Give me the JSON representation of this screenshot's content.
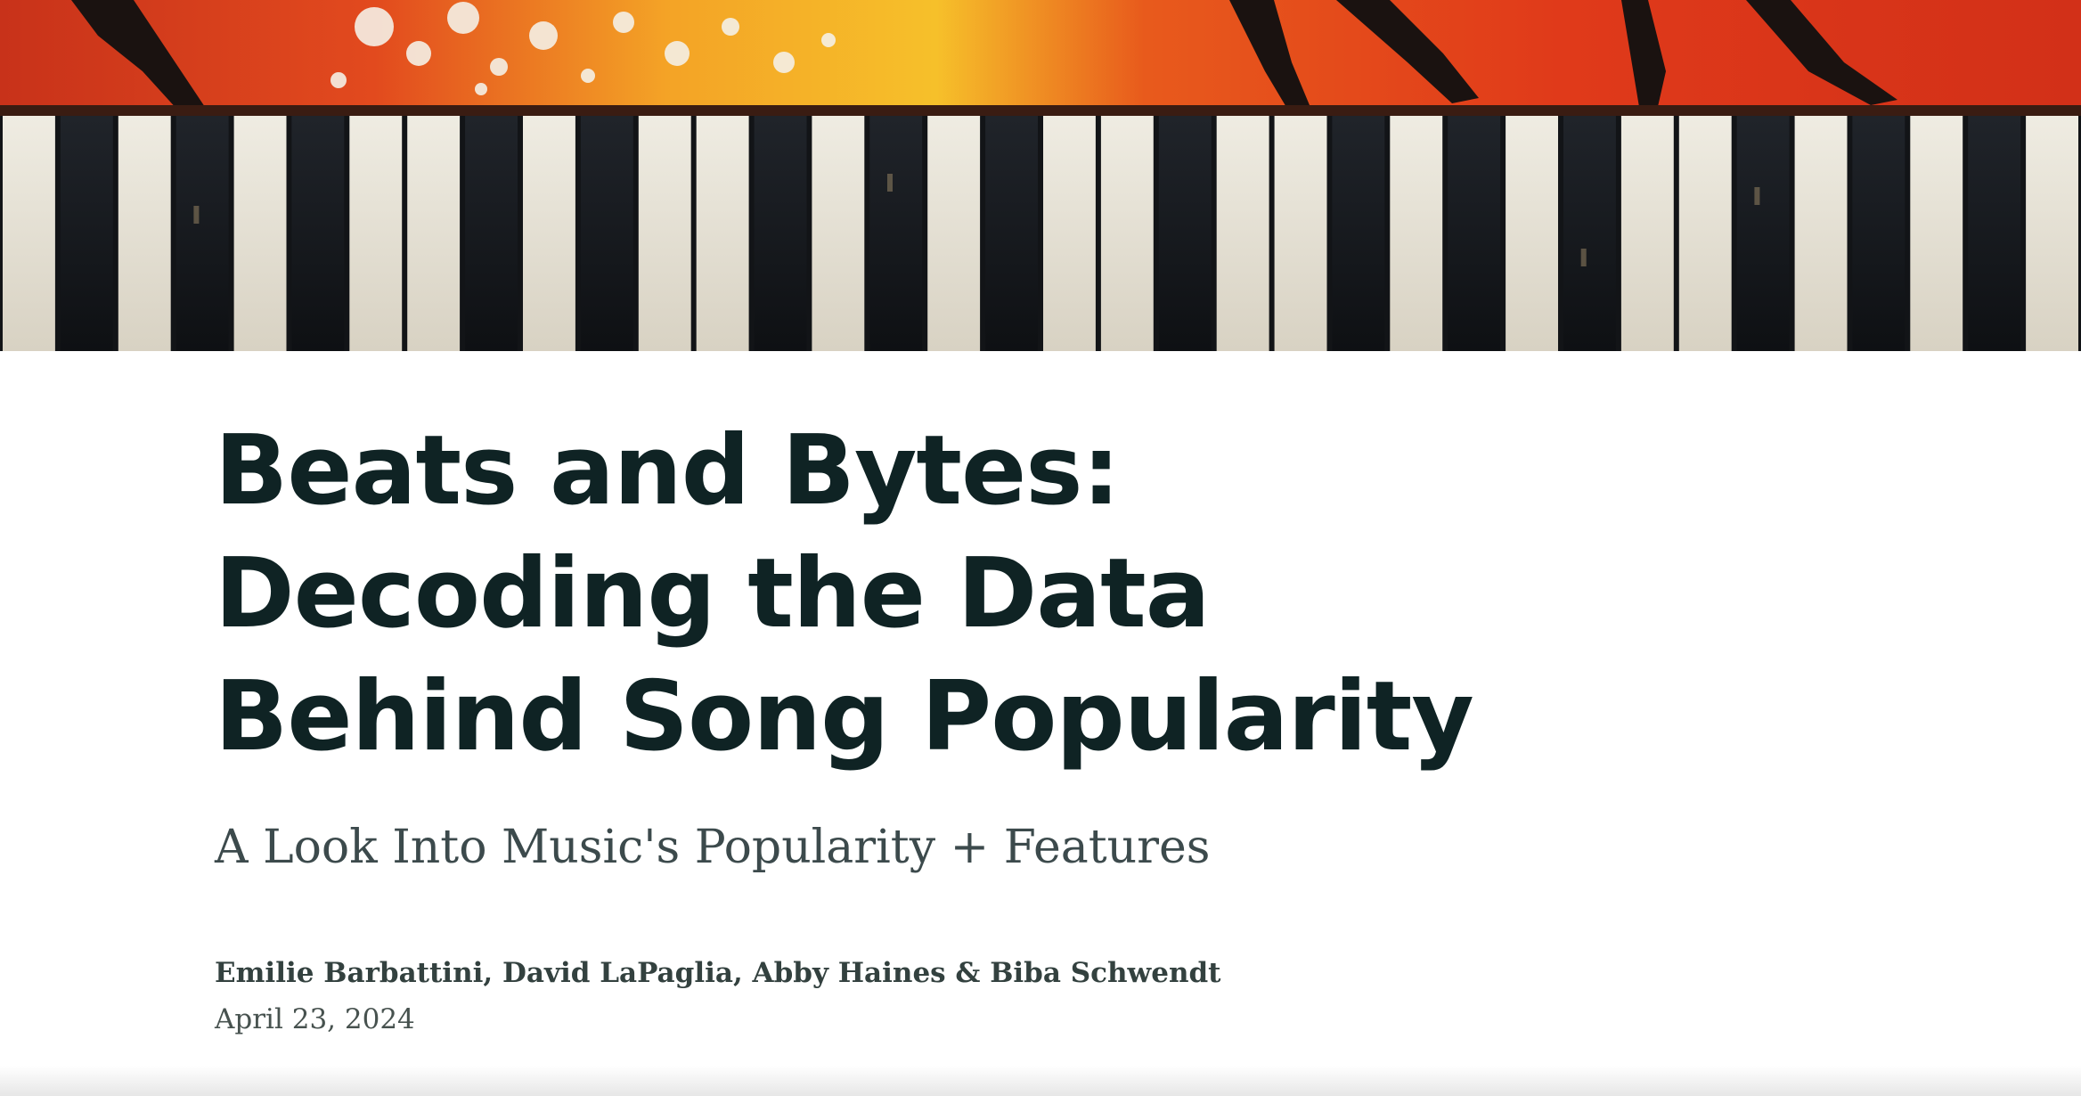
{
  "hero": {
    "image": "painted-piano-keys-photo",
    "colors": {
      "paint_red": "#d8371c",
      "paint_orange": "#f08a1c",
      "paint_yellow": "#f6c02a",
      "key_white": "#e8e4d8",
      "key_black": "#141619"
    }
  },
  "article": {
    "title": "Beats and Bytes: Decoding the Data Behind Song Popularity",
    "subtitle": "A Look Into Music's Popularity + Features",
    "authors": "Emilie Barbattini, David LaPaglia, Abby Haines & Biba Schwendt",
    "date": "April 23, 2024"
  }
}
